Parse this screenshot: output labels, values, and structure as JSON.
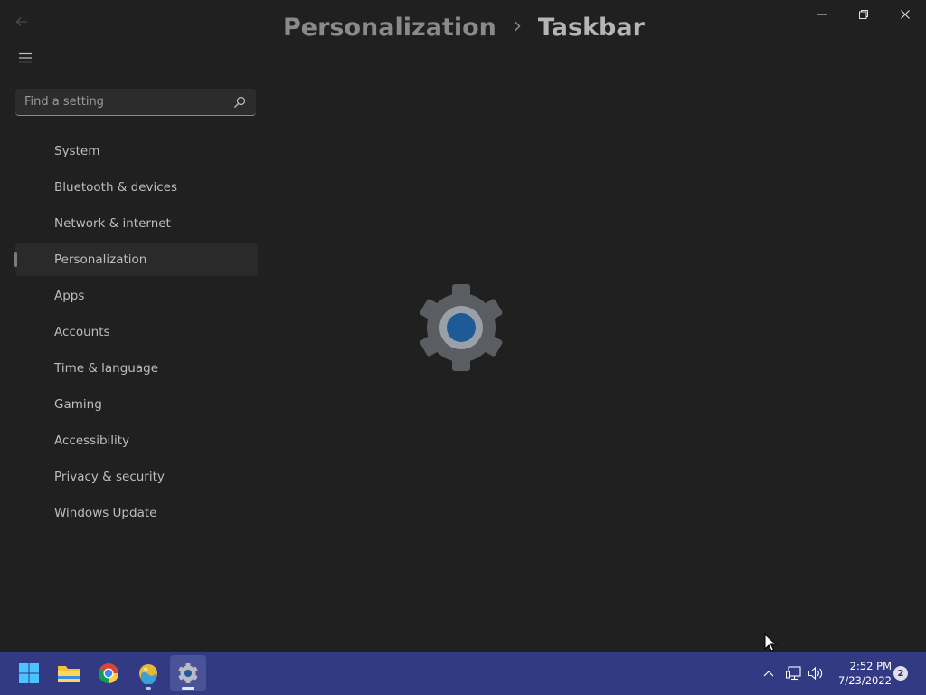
{
  "window": {
    "controls": {
      "minimize_icon": "minimize-icon",
      "maximize_icon": "restore-icon",
      "close_icon": "close-icon"
    }
  },
  "breadcrumb": {
    "parent": "Personalization",
    "separator": ">",
    "current": "Taskbar"
  },
  "search": {
    "placeholder": "Find a setting",
    "value": ""
  },
  "sidebar": {
    "items": [
      {
        "label": "System"
      },
      {
        "label": "Bluetooth & devices"
      },
      {
        "label": "Network & internet"
      },
      {
        "label": "Personalization",
        "selected": true
      },
      {
        "label": "Apps"
      },
      {
        "label": "Accounts"
      },
      {
        "label": "Time & language"
      },
      {
        "label": "Gaming"
      },
      {
        "label": "Accessibility"
      },
      {
        "label": "Privacy & security"
      },
      {
        "label": "Windows Update"
      }
    ]
  },
  "taskbar": {
    "apps": [
      "windows-start-icon",
      "file-explorer-icon",
      "chrome-icon",
      "photo-app-icon",
      "settings-icon"
    ],
    "clock": {
      "time": "2:52 PM",
      "date": "7/23/2022"
    },
    "notifications": "2"
  },
  "colors": {
    "window_bg": "#202020",
    "taskbar_bg": "#313a82",
    "accent_blue": "#1e5a96"
  }
}
